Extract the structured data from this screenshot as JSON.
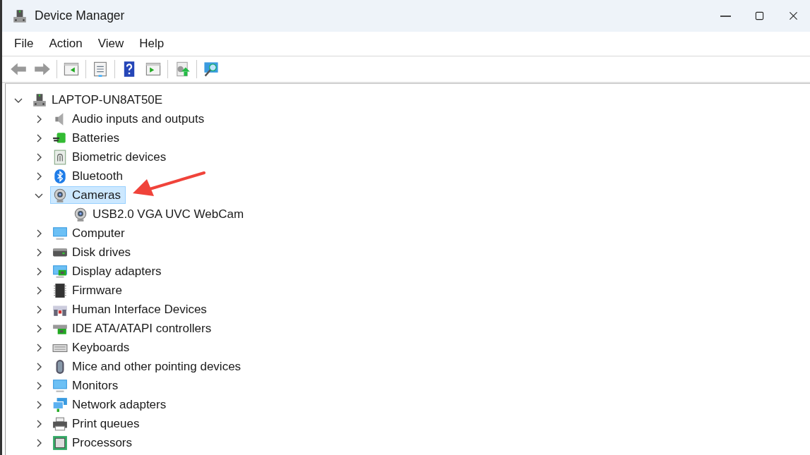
{
  "window": {
    "title": "Device Manager"
  },
  "menu": [
    "File",
    "Action",
    "View",
    "Help"
  ],
  "tree": {
    "label": "LAPTOP-UN8AT50E",
    "expanded": true,
    "selected": false,
    "children": [
      {
        "label": "Audio inputs and outputs",
        "expanded": false,
        "selected": false
      },
      {
        "label": "Batteries",
        "expanded": false,
        "selected": false
      },
      {
        "label": "Biometric devices",
        "expanded": false,
        "selected": false
      },
      {
        "label": "Bluetooth",
        "expanded": false,
        "selected": false
      },
      {
        "label": "Cameras",
        "expanded": true,
        "selected": true,
        "children": [
          {
            "label": "USB2.0 VGA UVC WebCam",
            "selected": false
          }
        ]
      },
      {
        "label": "Computer",
        "expanded": false,
        "selected": false
      },
      {
        "label": "Disk drives",
        "expanded": false,
        "selected": false
      },
      {
        "label": "Display adapters",
        "expanded": false,
        "selected": false
      },
      {
        "label": "Firmware",
        "expanded": false,
        "selected": false
      },
      {
        "label": "Human Interface Devices",
        "expanded": false,
        "selected": false
      },
      {
        "label": "IDE ATA/ATAPI controllers",
        "expanded": false,
        "selected": false
      },
      {
        "label": "Keyboards",
        "expanded": false,
        "selected": false
      },
      {
        "label": "Mice and other pointing devices",
        "expanded": false,
        "selected": false
      },
      {
        "label": "Monitors",
        "expanded": false,
        "selected": false
      },
      {
        "label": "Network adapters",
        "expanded": false,
        "selected": false
      },
      {
        "label": "Print queues",
        "expanded": false,
        "selected": false
      },
      {
        "label": "Processors",
        "expanded": false,
        "selected": false
      }
    ]
  }
}
